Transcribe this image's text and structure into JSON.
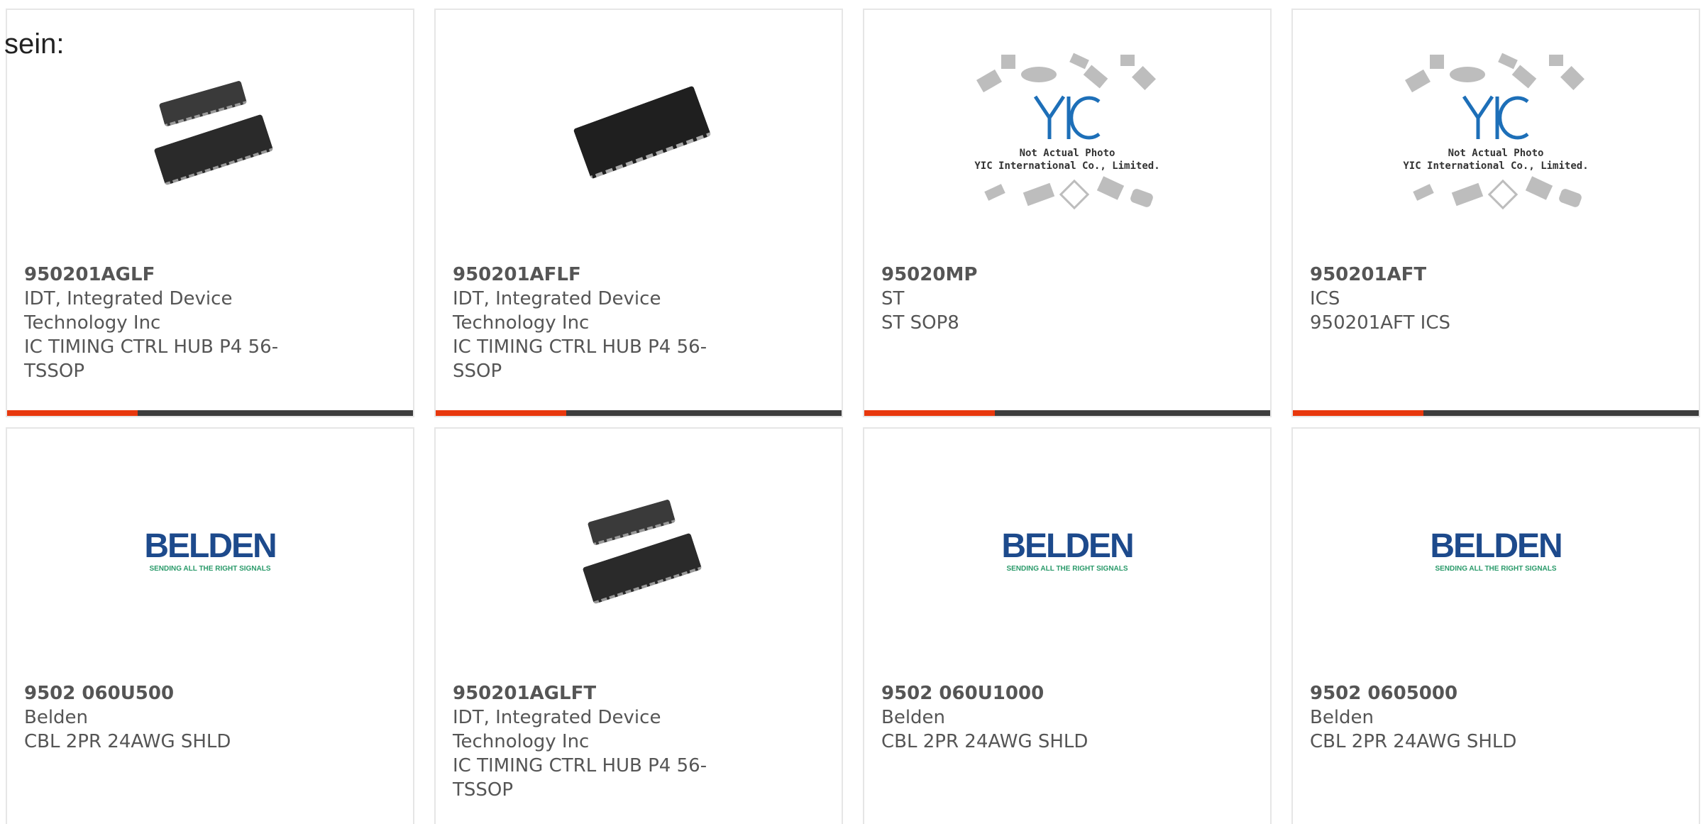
{
  "intro_text": "sein:",
  "colors": {
    "accent": "#e8380d",
    "bar": "#3d3d3d",
    "belden_blue": "#1d4a8c",
    "belden_green": "#2a9a6a"
  },
  "logos": {
    "yic_line1": "Not Actual Photo",
    "yic_line2": "YIC International Co., Limited.",
    "belden_word": "BELDEN",
    "belden_tagline": "SENDING ALL THE RIGHT SIGNALS"
  },
  "products": [
    {
      "part_number": "950201AGLF",
      "manufacturer": "IDT, Integrated Device Technology Inc",
      "description": "IC TIMING CTRL HUB P4 56-TSSOP",
      "image": "chip-pair-photo"
    },
    {
      "part_number": "950201AFLF",
      "manufacturer": "IDT, Integrated Device Technology Inc",
      "description": "IC TIMING CTRL HUB P4 56-SSOP",
      "image": "chip-single-photo"
    },
    {
      "part_number": "95020MP",
      "manufacturer": "ST",
      "description": "ST SOP8",
      "image": "yic-placeholder"
    },
    {
      "part_number": "950201AFT",
      "manufacturer": "ICS",
      "description": "950201AFT ICS",
      "image": "yic-placeholder"
    },
    {
      "part_number": "9502 060U500",
      "manufacturer": "Belden",
      "description": "CBL 2PR 24AWG SHLD",
      "image": "belden-logo"
    },
    {
      "part_number": "950201AGLFT",
      "manufacturer": "IDT, Integrated Device Technology Inc",
      "description": "IC TIMING CTRL HUB P4 56-TSSOP",
      "image": "chip-pair-photo"
    },
    {
      "part_number": "9502 060U1000",
      "manufacturer": "Belden",
      "description": "CBL 2PR 24AWG SHLD",
      "image": "belden-logo"
    },
    {
      "part_number": "9502 0605000",
      "manufacturer": "Belden",
      "description": "CBL 2PR 24AWG SHLD",
      "image": "belden-logo"
    }
  ]
}
